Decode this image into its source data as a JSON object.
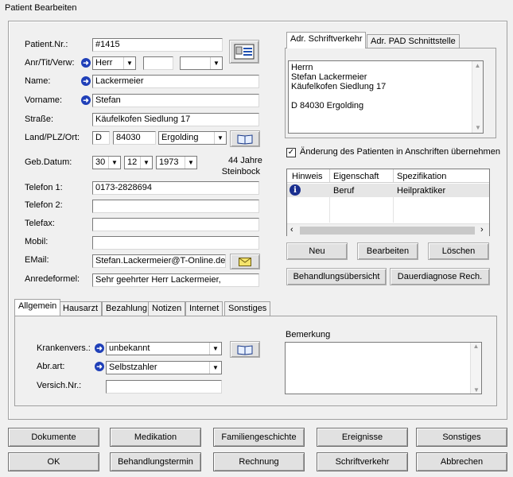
{
  "window": {
    "title": "Patient Bearbeiten"
  },
  "labels": {
    "patient_nr": "Patient.Nr.:",
    "anr": "Anr/Tit/Verw:",
    "name": "Name:",
    "vorname": "Vorname:",
    "strasse": "Straße:",
    "land": "Land/PLZ/Ort:",
    "geb": "Geb.Datum:",
    "telefon1": "Telefon 1:",
    "telefon2": "Telefon 2:",
    "telefax": "Telefax:",
    "mobil": "Mobil:",
    "email": "EMail:",
    "anrede": "Anredeformel:"
  },
  "values": {
    "patient_nr": "#1415",
    "anrede": "Herr",
    "titel": "",
    "verwandt": "",
    "name": "Lackermeier",
    "vorname": "Stefan",
    "strasse": "Käufelkofen Siedlung 17",
    "land": "D",
    "plz": "84030",
    "ort": "Ergolding",
    "geb_tag": "30",
    "geb_monat": "12",
    "geb_jahr": "1973",
    "alter": "44 Jahre",
    "sternzeichen": "Steinbock",
    "telefon1": "0173-2828694",
    "telefon2": "",
    "telefax": "",
    "mobil": "",
    "email": "Stefan.Lackermeier@T-Online.de",
    "anredeformel": "Sehr geehrter Herr Lackermeier,"
  },
  "address_tabs": [
    "Adr. Schriftverkehr",
    "Adr. PAD Schnittstelle"
  ],
  "address_lines": [
    "Herrn",
    "Stefan Lackermeier",
    "Käufelkofen Siedlung 17",
    "",
    "D 84030 Ergolding"
  ],
  "checkbox_label": "Änderung des Patienten in Anschriften übernehmen",
  "table": {
    "headers": [
      "Hinweis",
      "Eigenschaft",
      "Spezifikation"
    ],
    "rows": [
      {
        "eigenschaft": "Beruf",
        "spezifikation": "Heilpraktiker"
      }
    ]
  },
  "right_buttons": {
    "neu": "Neu",
    "bearbeiten": "Bearbeiten",
    "loeschen": "Löschen",
    "behandlungsuebersicht": "Behandlungsübersicht",
    "dauerdiagnose": "Dauerdiagnose Rech."
  },
  "lower_tabs": [
    "Allgemein",
    "Hausarzt",
    "Bezahlung",
    "Notizen",
    "Internet",
    "Sonstiges"
  ],
  "allgemein": {
    "krankenvers_label": "Krankenvers.:",
    "krankenvers_value": "unbekannt",
    "abrart_label": "Abr.art:",
    "abrart_value": "Selbstzahler",
    "versich_label": "Versich.Nr.:",
    "versich_value": "",
    "bemerkung_label": "Bemerkung"
  },
  "bottom_buttons": {
    "dokumente": "Dokumente",
    "medikation": "Medikation",
    "familiengeschichte": "Familiengeschichte",
    "ereignisse": "Ereignisse",
    "sonstiges": "Sonstiges",
    "ok": "OK",
    "behandlungstermin": "Behandlungstermin",
    "rechnung": "Rechnung",
    "schriftverkehr": "Schriftverkehr",
    "abbrechen": "Abbrechen"
  }
}
